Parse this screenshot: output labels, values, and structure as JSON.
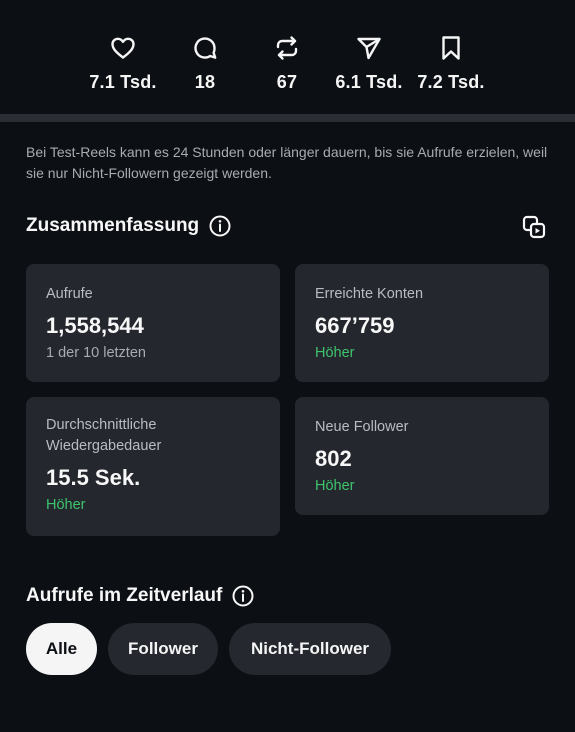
{
  "stats": [
    {
      "icon": "heart-icon",
      "value": "7.1 Tsd."
    },
    {
      "icon": "comment-icon",
      "value": "18"
    },
    {
      "icon": "repost-icon",
      "value": "67"
    },
    {
      "icon": "share-icon",
      "value": "6.1 Tsd."
    },
    {
      "icon": "bookmark-icon",
      "value": "7.2 Tsd."
    }
  ],
  "notice": "Bei Test-Reels kann es 24 Stunden oder länger dauern, bis sie Aufrufe erzielen, weil sie nur Nicht-Followern gezeigt werden.",
  "summary": {
    "title": "Zusammenfassung",
    "cards": {
      "views": {
        "label": "Aufrufe",
        "value": "1,558,544",
        "sub": "1 der 10 letzten"
      },
      "reached": {
        "label": "Erreichte Konten",
        "value": "667’759",
        "sub": "Höher"
      },
      "duration": {
        "label": "Durchschnittliche Wiedergabedauer",
        "value": "15.5 Sek.",
        "sub": "Höher"
      },
      "followers": {
        "label": "Neue Follower",
        "value": "802",
        "sub": "Höher"
      }
    }
  },
  "timeline": {
    "title": "Aufrufe im Zeitverlauf",
    "filters": [
      "Alle",
      "Follower",
      "Nicht-Follower"
    ],
    "active_filter": "Alle"
  },
  "colors": {
    "background": "#0c0f14",
    "card": "#24272d",
    "positive": "#3ec46d",
    "muted_text": "#a8abb2"
  }
}
